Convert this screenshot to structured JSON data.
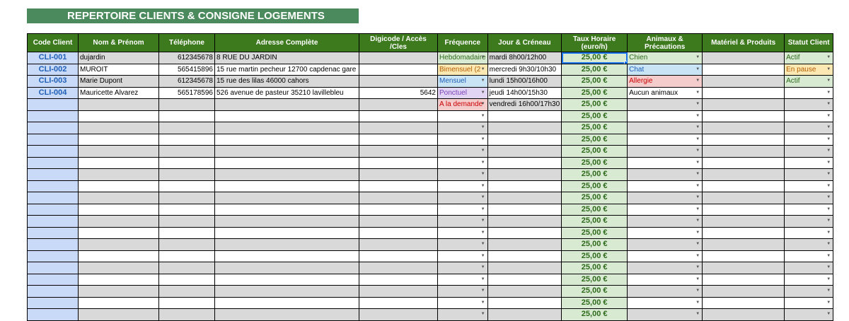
{
  "title": "REPERTOIRE CLIENTS & CONSIGNE LOGEMENTS",
  "colors": {
    "title_bg": "#4a8a5c",
    "header_bg": "#3c7a1d",
    "code_bg": "#c9daf8",
    "rate_bg": "#d9ead3",
    "hebdomadaire": "#d9ead3",
    "bimensuel": "#fce8b2",
    "mensuel": "#c9e4f5",
    "ponctuel": "#e1d5f3",
    "a_la_demande": "#f4cccc",
    "chien": "#d9ead3",
    "chat": "#c9e4f5",
    "allergie": "#f4cccc",
    "actif": "#d9ead3",
    "en_pause": "#fce8b2"
  },
  "headers": [
    "Code Client",
    "Nom & Prénom",
    "Téléphone",
    "Adresse Complète",
    "Digicode / Accès /Cles",
    "Fréquence",
    "Jour & Créneau",
    "Taux Horaire (euro/h)",
    "Animaux & Précautions",
    "Matériel & Produits",
    "Statut Client"
  ],
  "rows": [
    {
      "code": "CLI-001",
      "nom": "dujardin",
      "tel": "612345678",
      "adresse": "8 RUE DU JARDIN",
      "digicode": "",
      "frequence": "Hebdomadaire",
      "frequence_color": "#d9ead3",
      "frequence_text_color": "#2d6a1a",
      "jour": "mardi 8h00/12h00",
      "taux": "25,00 €",
      "animaux": "Chien",
      "animaux_color": "#d9ead3",
      "animaux_text_color": "#2d6a1a",
      "materiel": "",
      "statut": "Actif",
      "statut_color": "#d9ead3",
      "statut_text_color": "#2d6a1a"
    },
    {
      "code": "CLI-002",
      "nom": "MUROIT",
      "tel": "565415896",
      "adresse": "15 rue martin pecheur 12700 capdenac gare",
      "digicode": "",
      "frequence": "Bimensuel (2",
      "frequence_color": "#fce8b2",
      "frequence_text_color": "#b45f06",
      "jour": "mercredi 9h30/10h30",
      "taux": "25,00 €",
      "animaux": "Chat",
      "animaux_color": "#c9e4f5",
      "animaux_text_color": "#1f5fb8",
      "materiel": "",
      "statut": "En pause",
      "statut_color": "#fce8b2",
      "statut_text_color": "#b45f06"
    },
    {
      "code": "CLI-003",
      "nom": "Marie Dupont",
      "tel": "612345678",
      "adresse": "15 rue des lilas 46000 cahors",
      "digicode": "",
      "frequence": "Mensuel",
      "frequence_color": "#c9e4f5",
      "frequence_text_color": "#1f5fb8",
      "jour": "lundi 15h00/16h00",
      "taux": "25,00 €",
      "animaux": "Allergie",
      "animaux_color": "#f4cccc",
      "animaux_text_color": "#cc0000",
      "materiel": "",
      "statut": "Actif",
      "statut_color": "#d9ead3",
      "statut_text_color": "#2d6a1a"
    },
    {
      "code": "CLI-004",
      "nom": "Mauricette Alvarez",
      "tel": "565178596",
      "adresse": "526 avenue de pasteur 35210 lavillebleu",
      "digicode": "5642",
      "frequence": "Ponctuel",
      "frequence_color": "#e1d5f3",
      "frequence_text_color": "#7b3fb8",
      "jour": "jeudi 14h00/15h30",
      "taux": "25,00 €",
      "animaux": "Aucun animaux",
      "animaux_color": "",
      "animaux_text_color": "#000000",
      "materiel": "",
      "statut": "",
      "statut_color": "",
      "statut_text_color": "#000000"
    },
    {
      "code": "",
      "nom": "",
      "tel": "",
      "adresse": "",
      "digicode": "",
      "frequence": "A la demande",
      "frequence_color": "#f4cccc",
      "frequence_text_color": "#cc0000",
      "jour": "vendredi 16h00/17h30",
      "taux": "25,00 €",
      "animaux": "",
      "animaux_color": "",
      "animaux_text_color": "#000000",
      "materiel": "",
      "statut": "",
      "statut_color": "",
      "statut_text_color": "#000000"
    },
    {
      "code": "",
      "nom": "",
      "tel": "",
      "adresse": "",
      "digicode": "",
      "frequence": "",
      "frequence_color": "",
      "frequence_text_color": "#000",
      "jour": "",
      "taux": "25,00 €",
      "animaux": "",
      "animaux_color": "",
      "animaux_text_color": "#000",
      "materiel": "",
      "statut": "",
      "statut_color": "",
      "statut_text_color": "#000"
    },
    {
      "code": "",
      "nom": "",
      "tel": "",
      "adresse": "",
      "digicode": "",
      "frequence": "",
      "frequence_color": "",
      "frequence_text_color": "#000",
      "jour": "",
      "taux": "25,00 €",
      "animaux": "",
      "animaux_color": "",
      "animaux_text_color": "#000",
      "materiel": "",
      "statut": "",
      "statut_color": "",
      "statut_text_color": "#000"
    },
    {
      "code": "",
      "nom": "",
      "tel": "",
      "adresse": "",
      "digicode": "",
      "frequence": "",
      "frequence_color": "",
      "frequence_text_color": "#000",
      "jour": "",
      "taux": "25,00 €",
      "animaux": "",
      "animaux_color": "",
      "animaux_text_color": "#000",
      "materiel": "",
      "statut": "",
      "statut_color": "",
      "statut_text_color": "#000"
    },
    {
      "code": "",
      "nom": "",
      "tel": "",
      "adresse": "",
      "digicode": "",
      "frequence": "",
      "frequence_color": "",
      "frequence_text_color": "#000",
      "jour": "",
      "taux": "25,00 €",
      "animaux": "",
      "animaux_color": "",
      "animaux_text_color": "#000",
      "materiel": "",
      "statut": "",
      "statut_color": "",
      "statut_text_color": "#000"
    },
    {
      "code": "",
      "nom": "",
      "tel": "",
      "adresse": "",
      "digicode": "",
      "frequence": "",
      "frequence_color": "",
      "frequence_text_color": "#000",
      "jour": "",
      "taux": "25,00 €",
      "animaux": "",
      "animaux_color": "",
      "animaux_text_color": "#000",
      "materiel": "",
      "statut": "",
      "statut_color": "",
      "statut_text_color": "#000"
    },
    {
      "code": "",
      "nom": "",
      "tel": "",
      "adresse": "",
      "digicode": "",
      "frequence": "",
      "frequence_color": "",
      "frequence_text_color": "#000",
      "jour": "",
      "taux": "25,00 €",
      "animaux": "",
      "animaux_color": "",
      "animaux_text_color": "#000",
      "materiel": "",
      "statut": "",
      "statut_color": "",
      "statut_text_color": "#000"
    },
    {
      "code": "",
      "nom": "",
      "tel": "",
      "adresse": "",
      "digicode": "",
      "frequence": "",
      "frequence_color": "",
      "frequence_text_color": "#000",
      "jour": "",
      "taux": "25,00 €",
      "animaux": "",
      "animaux_color": "",
      "animaux_text_color": "#000",
      "materiel": "",
      "statut": "",
      "statut_color": "",
      "statut_text_color": "#000"
    },
    {
      "code": "",
      "nom": "",
      "tel": "",
      "adresse": "",
      "digicode": "",
      "frequence": "",
      "frequence_color": "",
      "frequence_text_color": "#000",
      "jour": "",
      "taux": "25,00 €",
      "animaux": "",
      "animaux_color": "",
      "animaux_text_color": "#000",
      "materiel": "",
      "statut": "",
      "statut_color": "",
      "statut_text_color": "#000"
    },
    {
      "code": "",
      "nom": "",
      "tel": "",
      "adresse": "",
      "digicode": "",
      "frequence": "",
      "frequence_color": "",
      "frequence_text_color": "#000",
      "jour": "",
      "taux": "25,00 €",
      "animaux": "",
      "animaux_color": "",
      "animaux_text_color": "#000",
      "materiel": "",
      "statut": "",
      "statut_color": "",
      "statut_text_color": "#000"
    },
    {
      "code": "",
      "nom": "",
      "tel": "",
      "adresse": "",
      "digicode": "",
      "frequence": "",
      "frequence_color": "",
      "frequence_text_color": "#000",
      "jour": "",
      "taux": "25,00 €",
      "animaux": "",
      "animaux_color": "",
      "animaux_text_color": "#000",
      "materiel": "",
      "statut": "",
      "statut_color": "",
      "statut_text_color": "#000"
    },
    {
      "code": "",
      "nom": "",
      "tel": "",
      "adresse": "",
      "digicode": "",
      "frequence": "",
      "frequence_color": "",
      "frequence_text_color": "#000",
      "jour": "",
      "taux": "25,00 €",
      "animaux": "",
      "animaux_color": "",
      "animaux_text_color": "#000",
      "materiel": "",
      "statut": "",
      "statut_color": "",
      "statut_text_color": "#000"
    },
    {
      "code": "",
      "nom": "",
      "tel": "",
      "adresse": "",
      "digicode": "",
      "frequence": "",
      "frequence_color": "",
      "frequence_text_color": "#000",
      "jour": "",
      "taux": "25,00 €",
      "animaux": "",
      "animaux_color": "",
      "animaux_text_color": "#000",
      "materiel": "",
      "statut": "",
      "statut_color": "",
      "statut_text_color": "#000"
    },
    {
      "code": "",
      "nom": "",
      "tel": "",
      "adresse": "",
      "digicode": "",
      "frequence": "",
      "frequence_color": "",
      "frequence_text_color": "#000",
      "jour": "",
      "taux": "25,00 €",
      "animaux": "",
      "animaux_color": "",
      "animaux_text_color": "#000",
      "materiel": "",
      "statut": "",
      "statut_color": "",
      "statut_text_color": "#000"
    },
    {
      "code": "",
      "nom": "",
      "tel": "",
      "adresse": "",
      "digicode": "",
      "frequence": "",
      "frequence_color": "",
      "frequence_text_color": "#000",
      "jour": "",
      "taux": "25,00 €",
      "animaux": "",
      "animaux_color": "",
      "animaux_text_color": "#000",
      "materiel": "",
      "statut": "",
      "statut_color": "",
      "statut_text_color": "#000"
    },
    {
      "code": "",
      "nom": "",
      "tel": "",
      "adresse": "",
      "digicode": "",
      "frequence": "",
      "frequence_color": "",
      "frequence_text_color": "#000",
      "jour": "",
      "taux": "25,00 €",
      "animaux": "",
      "animaux_color": "",
      "animaux_text_color": "#000",
      "materiel": "",
      "statut": "",
      "statut_color": "",
      "statut_text_color": "#000"
    },
    {
      "code": "",
      "nom": "",
      "tel": "",
      "adresse": "",
      "digicode": "",
      "frequence": "",
      "frequence_color": "",
      "frequence_text_color": "#000",
      "jour": "",
      "taux": "25,00 €",
      "animaux": "",
      "animaux_color": "",
      "animaux_text_color": "#000",
      "materiel": "",
      "statut": "",
      "statut_color": "",
      "statut_text_color": "#000"
    },
    {
      "code": "",
      "nom": "",
      "tel": "",
      "adresse": "",
      "digicode": "",
      "frequence": "",
      "frequence_color": "",
      "frequence_text_color": "#000",
      "jour": "",
      "taux": "25,00 €",
      "animaux": "",
      "animaux_color": "",
      "animaux_text_color": "#000",
      "materiel": "",
      "statut": "",
      "statut_color": "",
      "statut_text_color": "#000"
    },
    {
      "code": "",
      "nom": "",
      "tel": "",
      "adresse": "",
      "digicode": "",
      "frequence": "",
      "frequence_color": "",
      "frequence_text_color": "#000",
      "jour": "",
      "taux": "25,00 €",
      "animaux": "",
      "animaux_color": "",
      "animaux_text_color": "#000",
      "materiel": "",
      "statut": "",
      "statut_color": "",
      "statut_text_color": "#000"
    }
  ]
}
